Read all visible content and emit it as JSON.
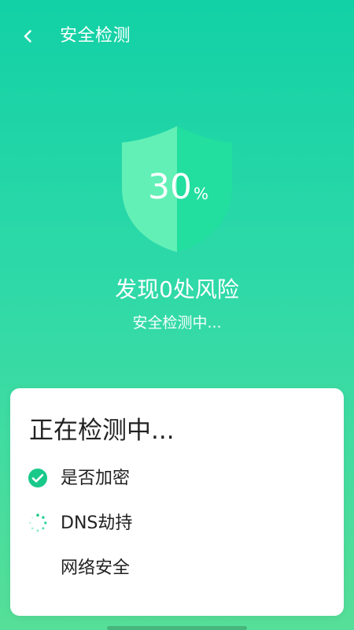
{
  "header": {
    "title": "安全检测",
    "back_icon": "chevron-left-icon"
  },
  "scan": {
    "progress_value": "30",
    "progress_unit": "%",
    "progress_percent": 30,
    "risk_title": "发现0处风险",
    "status_text": "安全检测中..."
  },
  "card": {
    "title": "正在检测中...",
    "items": [
      {
        "label": "是否加密",
        "state": "done",
        "icon": "check-circle-icon"
      },
      {
        "label": "DNS劫持",
        "state": "loading",
        "icon": "loading-spinner-icon"
      },
      {
        "label": "网络安全",
        "state": "pending",
        "icon": ""
      }
    ]
  },
  "colors": {
    "accent": "#18c98a",
    "shield_light": "#5ff0b2",
    "shield_dark": "#23e0a0",
    "background_top": "#12d1a6",
    "background_bottom": "#56df98",
    "card_bg": "#ffffff",
    "text_primary": "#222222"
  }
}
